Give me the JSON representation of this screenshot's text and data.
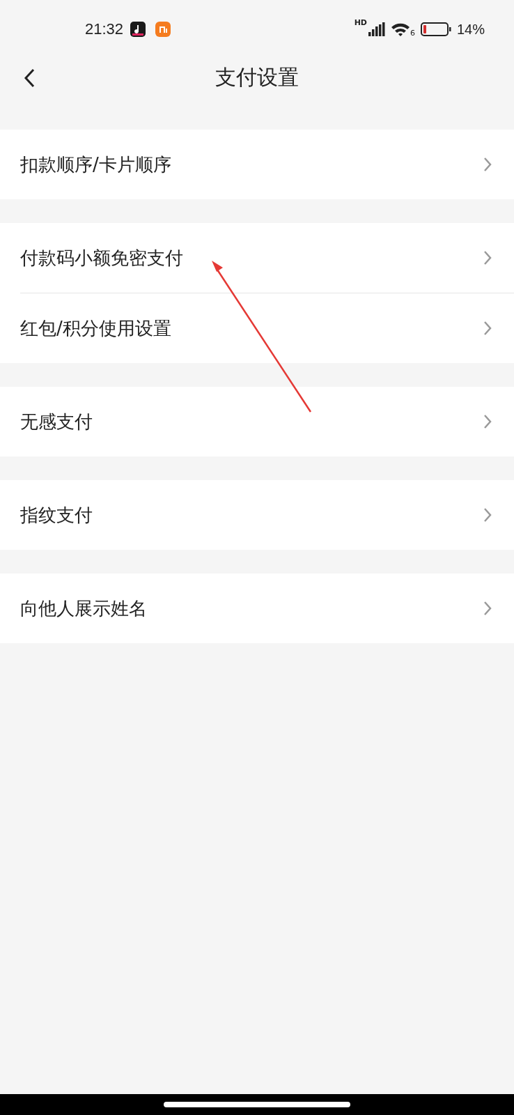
{
  "status_bar": {
    "time": "21:32",
    "signal_label": "HD",
    "wifi_label": "6",
    "battery": "14%"
  },
  "header": {
    "title": "支付设置"
  },
  "groups": [
    {
      "items": [
        {
          "label": "扣款顺序/卡片顺序"
        }
      ]
    },
    {
      "items": [
        {
          "label": "付款码小额免密支付"
        },
        {
          "label": "红包/积分使用设置"
        }
      ]
    },
    {
      "items": [
        {
          "label": "无感支付"
        }
      ]
    },
    {
      "items": [
        {
          "label": "指纹支付"
        }
      ]
    },
    {
      "items": [
        {
          "label": "向他人展示姓名"
        }
      ]
    }
  ]
}
